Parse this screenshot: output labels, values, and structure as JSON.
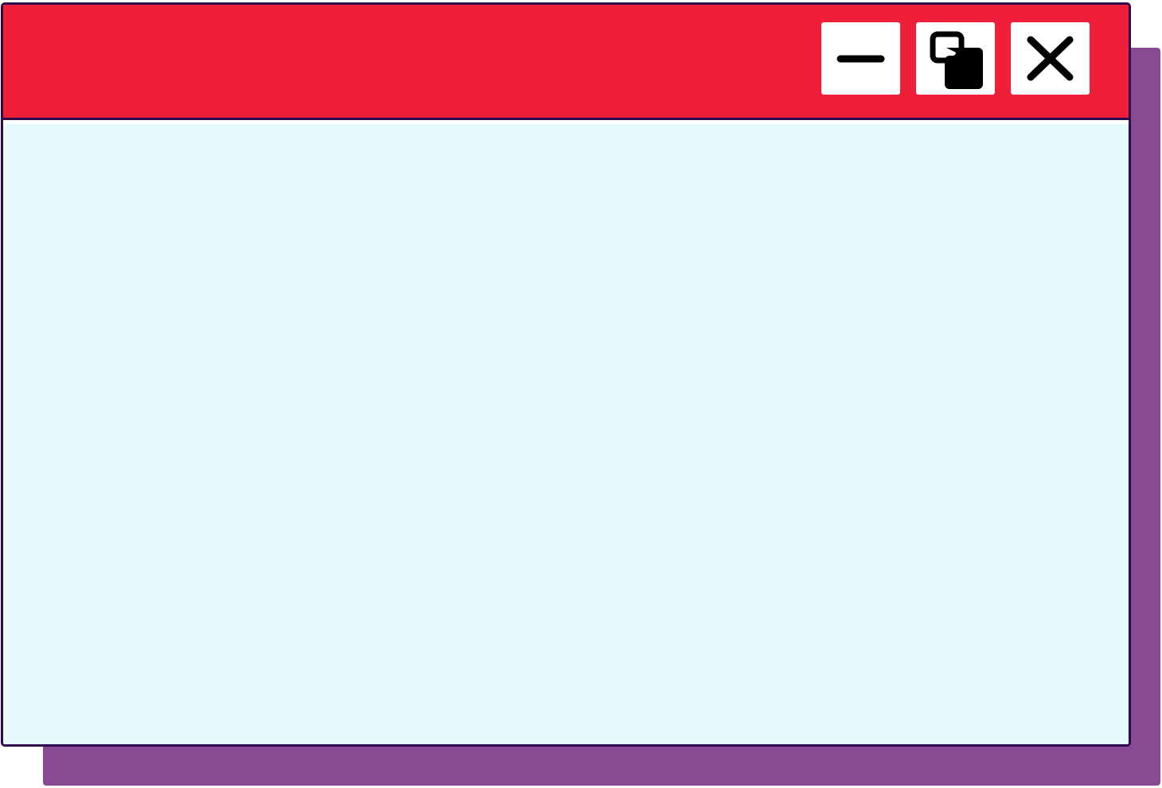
{
  "window": {
    "buttons": [
      {
        "name": "minimize",
        "icon": "minimize-icon"
      },
      {
        "name": "restore",
        "icon": "restore-icon"
      },
      {
        "name": "close",
        "icon": "close-icon"
      }
    ]
  },
  "colors": {
    "titlebar": "#ef1f39",
    "content": "#e6fbff",
    "shadow": "#884a92",
    "border": "#2e0a4f",
    "button": "#ffffff",
    "icon": "#000000"
  }
}
